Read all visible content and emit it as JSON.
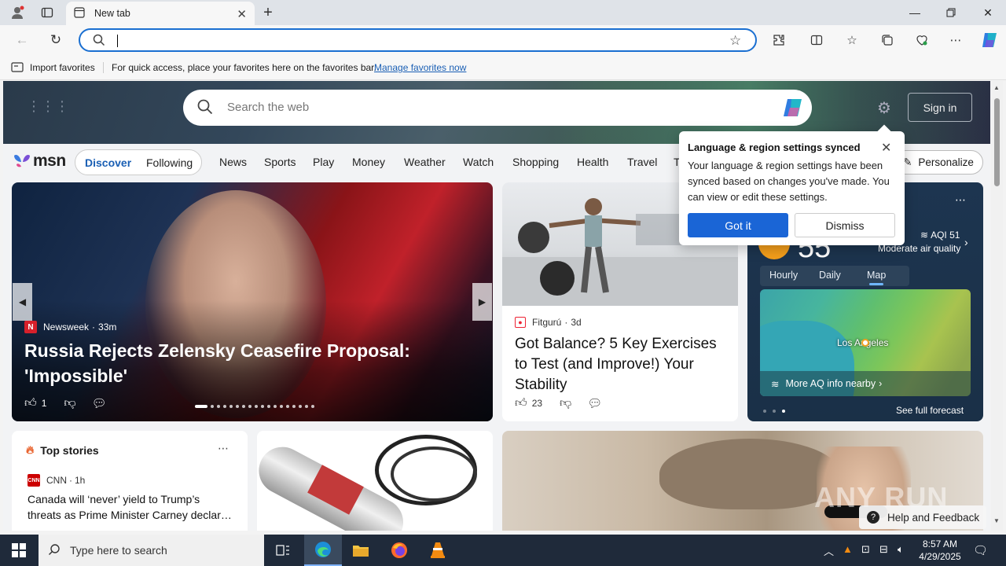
{
  "browser": {
    "tab_title": "New tab",
    "address_value": "",
    "favorites_import": "Import favorites",
    "favorites_hint": "For quick access, place your favorites here on the favorites bar.",
    "favorites_link": "Manage favorites now"
  },
  "hero": {
    "search_placeholder": "Search the web",
    "sign_in": "Sign in"
  },
  "nav": {
    "logo": "msn",
    "pill": [
      "Discover",
      "Following"
    ],
    "items": [
      "News",
      "Sports",
      "Play",
      "Money",
      "Weather",
      "Watch",
      "Shopping",
      "Health",
      "Travel",
      "T"
    ],
    "personalize": "Personalize"
  },
  "main_story": {
    "source": "Newsweek",
    "source_initial": "N",
    "age": "33m",
    "title": "Russia Rejects Zelensky Ceasefire Proposal: 'Impossible'",
    "likes": "1"
  },
  "fit_story": {
    "source": "Fitgurú",
    "age": "3d",
    "title": "Got Balance? 5 Key Exercises to Test (and Improve!) Your Stability",
    "likes": "23"
  },
  "weather": {
    "aqi": "AQI 51",
    "aqi_desc": "Moderate air quality",
    "tabs": [
      "Hourly",
      "Daily",
      "Map"
    ],
    "map_city": "Los Angeles",
    "more_aq": "More AQ info nearby",
    "forecast_link": "See full forecast"
  },
  "top_stories": {
    "heading": "Top stories",
    "source": "CNN",
    "source_badge": "CNN",
    "age": "1h",
    "title": "Canada will ‘never’ yield to Trump’s threats as Prime Minister Carney declar…"
  },
  "popup": {
    "title": "Language & region settings synced",
    "body": "Your language & region settings have been synced based on changes you've made. You can view or edit these settings.",
    "got_it": "Got it",
    "dismiss": "Dismiss"
  },
  "help": "Help and Feedback",
  "watermark": "ANY RUN",
  "taskbar": {
    "search_placeholder": "Type here to search",
    "time": "8:57 AM",
    "date": "4/29/2025"
  },
  "colors": {
    "accent": "#1a65d6",
    "address_border": "#1a6fd1",
    "taskbar": "#1f2a3a"
  }
}
